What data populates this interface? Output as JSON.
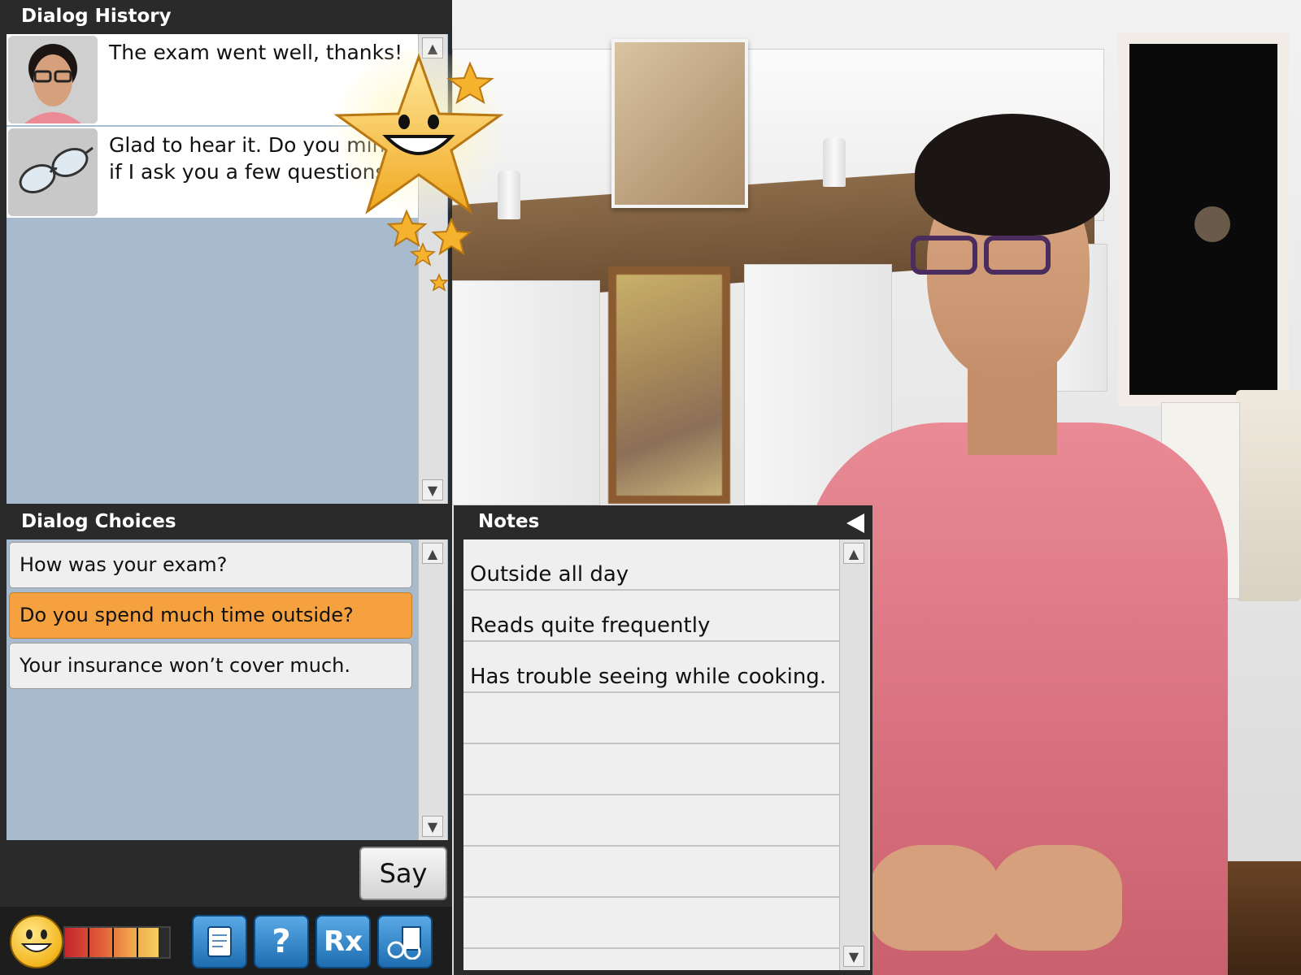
{
  "history": {
    "title": "Dialog History",
    "entries": [
      {
        "speaker_icon": "patient-avatar-icon",
        "text": "The exam went well, thanks!"
      },
      {
        "speaker_icon": "eyeglasses-icon",
        "text": "Glad to hear it. Do you mind if I ask you a few questions?"
      }
    ]
  },
  "choices": {
    "title": "Dialog Choices",
    "items": [
      {
        "label": "How was your exam?",
        "selected": false
      },
      {
        "label": "Do you spend much time outside?",
        "selected": true
      },
      {
        "label": "Your insurance won’t cover much.",
        "selected": false
      }
    ],
    "say_label": "Say"
  },
  "notes": {
    "title": "Notes",
    "items": [
      "Outside all day",
      "Reads quite frequently",
      "Has trouble seeing while cooking."
    ]
  },
  "toolbar": {
    "mood_icon": "smiley-face-icon",
    "mood_level": 0.9,
    "buttons": [
      {
        "icon": "notepad-icon"
      },
      {
        "icon": "help-question-icon",
        "label": "?"
      },
      {
        "icon": "prescription-rx-icon",
        "label": "Rx"
      },
      {
        "icon": "glasses-catalog-icon"
      }
    ]
  },
  "colors": {
    "selected_choice": "#f5a13f",
    "panel_header": "#2a2a2a",
    "panel_body": "#a8bacd",
    "toolbar_button": "#2f86cf"
  }
}
